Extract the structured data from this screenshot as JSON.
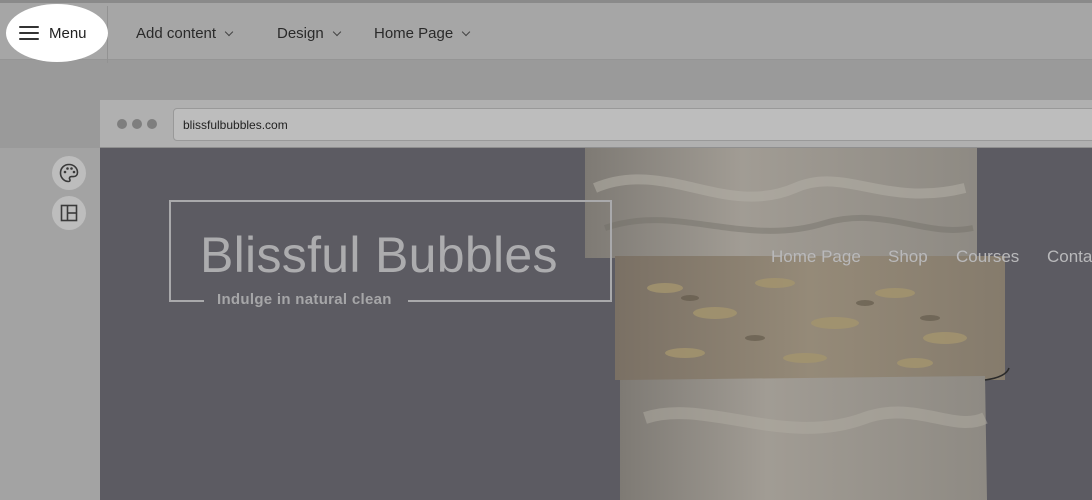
{
  "toolbar": {
    "menu_label": "Menu",
    "items": [
      {
        "label": "Add content"
      },
      {
        "label": "Design"
      },
      {
        "label": "Home Page"
      }
    ]
  },
  "side_tools": [
    {
      "icon": "palette-icon"
    },
    {
      "icon": "layout-icon"
    }
  ],
  "browser": {
    "url": "blissfulbubbles.com"
  },
  "site": {
    "brand": "Blissful Bubbles",
    "tagline": "Indulge in natural clean",
    "nav": [
      "Home Page",
      "Shop",
      "Courses",
      "Conta"
    ]
  },
  "colors": {
    "overlay_gray": "#a6a6a6",
    "hero_background": "#5c5b62",
    "highlight": "#ffffff"
  }
}
